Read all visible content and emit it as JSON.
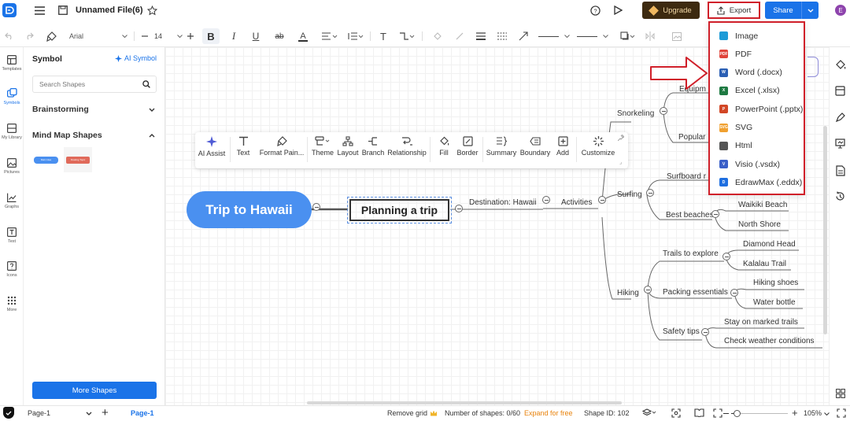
{
  "header": {
    "file_name": "Unnamed File(6)",
    "upgrade_label": "Upgrade",
    "export_label": "Export",
    "share_label": "Share",
    "avatar_letter": "E"
  },
  "toolbar": {
    "font_family": "Arial",
    "font_size": "14"
  },
  "rail": {
    "items": [
      "Templates",
      "Symbols",
      "My Library",
      "Pictures",
      "Graphs",
      "Text",
      "Icons",
      "More"
    ]
  },
  "sidebar": {
    "title": "Symbol",
    "ai_symbol": "AI Symbol",
    "search_placeholder": "Search Shapes",
    "section_brainstorming": "Brainstorming",
    "section_mindmap": "Mind Map Shapes",
    "thumb_main_idea": "Main Idea",
    "thumb_floating_topic": "Floating Topic",
    "more_shapes": "More Shapes"
  },
  "floatbar": {
    "items": [
      "AI Assist",
      "Text",
      "Format Pain...",
      "Theme",
      "Layout",
      "Branch",
      "Relationship",
      "Fill",
      "Border",
      "Summary",
      "Boundary",
      "Add",
      "Customize"
    ]
  },
  "mindmap": {
    "root": "Trip to Hawaii",
    "main": "Planning a trip",
    "destination": "Destination: Hawaii",
    "activities": "Activities",
    "snorkeling": "Snorkeling",
    "equipment": "Equipm",
    "popular": "Popular",
    "surfing": "Surfing",
    "surfboard": "Surfboard r",
    "best_beaches": "Best beaches",
    "waikiki": "Waikiki Beach",
    "north_shore": "North Shore",
    "hiking": "Hiking",
    "trails": "Trails to explore",
    "diamond_head": "Diamond Head",
    "kalalau": "Kalalau Trail",
    "packing": "Packing essentials",
    "hiking_shoes": "Hiking shoes",
    "water_bottle": "Water bottle",
    "safety": "Safety tips",
    "marked_trails": "Stay on marked trails",
    "weather": "Check weather conditions"
  },
  "export_menu": {
    "items": [
      {
        "label": "Image",
        "icon": "image-icon",
        "color": "#1e9bd7"
      },
      {
        "label": "PDF",
        "icon": "pdf-icon",
        "color": "#e0443b"
      },
      {
        "label": "Word (.docx)",
        "icon": "word-icon",
        "color": "#2b5fb4"
      },
      {
        "label": "Excel (.xlsx)",
        "icon": "excel-icon",
        "color": "#1e7a42"
      },
      {
        "label": "PowerPoint (.pptx)",
        "icon": "powerpoint-icon",
        "color": "#d24726"
      },
      {
        "label": "SVG",
        "icon": "svg-icon",
        "color": "#f0a030"
      },
      {
        "label": "Html",
        "icon": "html-icon",
        "color": "#555555"
      },
      {
        "label": "Visio (.vsdx)",
        "icon": "visio-icon",
        "color": "#3a5fc8"
      },
      {
        "label": "EdrawMax (.eddx)",
        "icon": "edrawmax-icon",
        "color": "#1f6fe0"
      }
    ]
  },
  "status": {
    "page_select": "Page-1",
    "page_tab": "Page-1",
    "remove_grid": "Remove grid",
    "shapes_count": "Number of shapes: 0/60",
    "expand": "Expand for free",
    "shape_id": "Shape ID: 102",
    "zoom": "105%"
  },
  "colors": {
    "accent": "#1a73e8",
    "root_bubble": "#4a90f0",
    "highlight": "#d0202a",
    "upgrade_bg": "#3d2a10"
  }
}
